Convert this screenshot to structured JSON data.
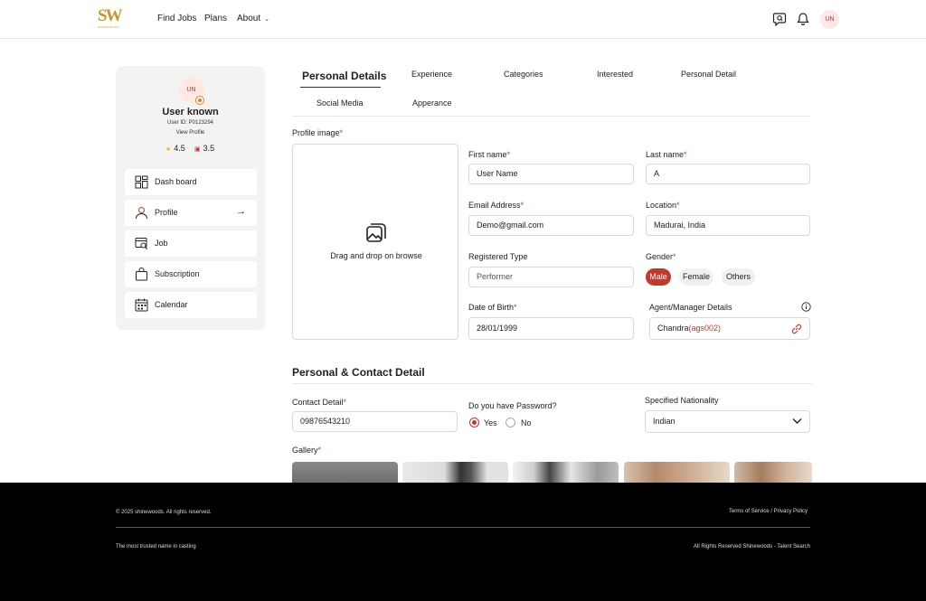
{
  "header": {
    "logo_text": "SW",
    "logo_sub": "SHINEWOODS",
    "nav": {
      "find_jobs": "Find Jobs",
      "plans": "Plans",
      "about": "About"
    },
    "avatar_initials": "UN"
  },
  "sidebar": {
    "avatar_initials": "UN",
    "name": "User known",
    "user_id": "User ID: P0123294",
    "view_profile": "View Profile",
    "rating_star": "4.5",
    "rating_cup": "3.5",
    "menu": [
      {
        "label": "Dash board",
        "icon": "dashboard-icon"
      },
      {
        "label": "Profile",
        "icon": "user-icon"
      },
      {
        "label": "Job",
        "icon": "job-search-icon"
      },
      {
        "label": "Subscription",
        "icon": "bag-icon"
      },
      {
        "label": "Calendar",
        "icon": "calendar-icon"
      }
    ]
  },
  "tabs": {
    "personal_details": "Personal Details",
    "experience": "Experience",
    "categories": "Categories",
    "interested": "Interested",
    "personal_detail": "Personal Detail",
    "social_media": "Social Media",
    "apperance": "Apperance"
  },
  "form": {
    "profile_image_label": "Profile image",
    "dropzone_text": "Drag and drop on browse",
    "first_name_label": "First name",
    "first_name_value": "User Name",
    "last_name_label": "Last name",
    "last_name_value": "A",
    "email_label": "Email Address",
    "email_value": "Demo@gmail.com",
    "location_label": "Location",
    "location_value": "Madurai, India",
    "registered_type_label": "Registered Type",
    "registered_type_placeholder": "Performer",
    "gender_label": "Gender",
    "gender_options": [
      "Male",
      "Female",
      "Others"
    ],
    "gender_selected": "Male",
    "dob_label": "Date of Birth",
    "dob_value": "28/01/1999",
    "agent_label": "Agent/Manager Details",
    "agent_name": "Chandra",
    "agent_code": "(ags002)",
    "required_mark": "*"
  },
  "contact": {
    "section_title": "Personal & Contact Detail",
    "contact_label": "Contact Detail",
    "contact_value": "09876543210",
    "password_question": "Do you have Password?",
    "password_yes": "Yes",
    "password_no": "No",
    "nationality_label": "Specified Nationality",
    "nationality_value": "Indian",
    "gallery_label": "Gallery"
  },
  "footer": {
    "copyright": "© 2025 shinewoods. All rights reserved.",
    "terms": "Terms of Service / Privacy Policy",
    "tagline": "The most trusted name in casting",
    "rights": "All Rights Reserved Shinewoods - Talent Search"
  },
  "colors": {
    "accent": "#c0392b",
    "brand_gold": "#c8962a",
    "footer_bg": "#000000"
  }
}
